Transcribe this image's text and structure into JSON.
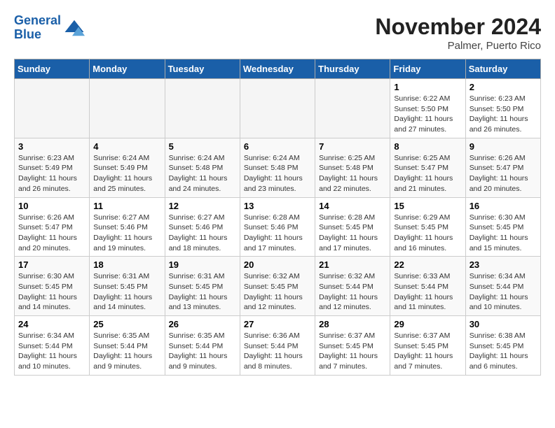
{
  "header": {
    "logo_line1": "General",
    "logo_line2": "Blue",
    "month": "November 2024",
    "location": "Palmer, Puerto Rico"
  },
  "weekdays": [
    "Sunday",
    "Monday",
    "Tuesday",
    "Wednesday",
    "Thursday",
    "Friday",
    "Saturday"
  ],
  "weeks": [
    [
      {
        "day": "",
        "info": ""
      },
      {
        "day": "",
        "info": ""
      },
      {
        "day": "",
        "info": ""
      },
      {
        "day": "",
        "info": ""
      },
      {
        "day": "",
        "info": ""
      },
      {
        "day": "1",
        "info": "Sunrise: 6:22 AM\nSunset: 5:50 PM\nDaylight: 11 hours and 27 minutes."
      },
      {
        "day": "2",
        "info": "Sunrise: 6:23 AM\nSunset: 5:50 PM\nDaylight: 11 hours and 26 minutes."
      }
    ],
    [
      {
        "day": "3",
        "info": "Sunrise: 6:23 AM\nSunset: 5:49 PM\nDaylight: 11 hours and 26 minutes."
      },
      {
        "day": "4",
        "info": "Sunrise: 6:24 AM\nSunset: 5:49 PM\nDaylight: 11 hours and 25 minutes."
      },
      {
        "day": "5",
        "info": "Sunrise: 6:24 AM\nSunset: 5:48 PM\nDaylight: 11 hours and 24 minutes."
      },
      {
        "day": "6",
        "info": "Sunrise: 6:24 AM\nSunset: 5:48 PM\nDaylight: 11 hours and 23 minutes."
      },
      {
        "day": "7",
        "info": "Sunrise: 6:25 AM\nSunset: 5:48 PM\nDaylight: 11 hours and 22 minutes."
      },
      {
        "day": "8",
        "info": "Sunrise: 6:25 AM\nSunset: 5:47 PM\nDaylight: 11 hours and 21 minutes."
      },
      {
        "day": "9",
        "info": "Sunrise: 6:26 AM\nSunset: 5:47 PM\nDaylight: 11 hours and 20 minutes."
      }
    ],
    [
      {
        "day": "10",
        "info": "Sunrise: 6:26 AM\nSunset: 5:47 PM\nDaylight: 11 hours and 20 minutes."
      },
      {
        "day": "11",
        "info": "Sunrise: 6:27 AM\nSunset: 5:46 PM\nDaylight: 11 hours and 19 minutes."
      },
      {
        "day": "12",
        "info": "Sunrise: 6:27 AM\nSunset: 5:46 PM\nDaylight: 11 hours and 18 minutes."
      },
      {
        "day": "13",
        "info": "Sunrise: 6:28 AM\nSunset: 5:46 PM\nDaylight: 11 hours and 17 minutes."
      },
      {
        "day": "14",
        "info": "Sunrise: 6:28 AM\nSunset: 5:45 PM\nDaylight: 11 hours and 17 minutes."
      },
      {
        "day": "15",
        "info": "Sunrise: 6:29 AM\nSunset: 5:45 PM\nDaylight: 11 hours and 16 minutes."
      },
      {
        "day": "16",
        "info": "Sunrise: 6:30 AM\nSunset: 5:45 PM\nDaylight: 11 hours and 15 minutes."
      }
    ],
    [
      {
        "day": "17",
        "info": "Sunrise: 6:30 AM\nSunset: 5:45 PM\nDaylight: 11 hours and 14 minutes."
      },
      {
        "day": "18",
        "info": "Sunrise: 6:31 AM\nSunset: 5:45 PM\nDaylight: 11 hours and 14 minutes."
      },
      {
        "day": "19",
        "info": "Sunrise: 6:31 AM\nSunset: 5:45 PM\nDaylight: 11 hours and 13 minutes."
      },
      {
        "day": "20",
        "info": "Sunrise: 6:32 AM\nSunset: 5:45 PM\nDaylight: 11 hours and 12 minutes."
      },
      {
        "day": "21",
        "info": "Sunrise: 6:32 AM\nSunset: 5:44 PM\nDaylight: 11 hours and 12 minutes."
      },
      {
        "day": "22",
        "info": "Sunrise: 6:33 AM\nSunset: 5:44 PM\nDaylight: 11 hours and 11 minutes."
      },
      {
        "day": "23",
        "info": "Sunrise: 6:34 AM\nSunset: 5:44 PM\nDaylight: 11 hours and 10 minutes."
      }
    ],
    [
      {
        "day": "24",
        "info": "Sunrise: 6:34 AM\nSunset: 5:44 PM\nDaylight: 11 hours and 10 minutes."
      },
      {
        "day": "25",
        "info": "Sunrise: 6:35 AM\nSunset: 5:44 PM\nDaylight: 11 hours and 9 minutes."
      },
      {
        "day": "26",
        "info": "Sunrise: 6:35 AM\nSunset: 5:44 PM\nDaylight: 11 hours and 9 minutes."
      },
      {
        "day": "27",
        "info": "Sunrise: 6:36 AM\nSunset: 5:44 PM\nDaylight: 11 hours and 8 minutes."
      },
      {
        "day": "28",
        "info": "Sunrise: 6:37 AM\nSunset: 5:45 PM\nDaylight: 11 hours and 7 minutes."
      },
      {
        "day": "29",
        "info": "Sunrise: 6:37 AM\nSunset: 5:45 PM\nDaylight: 11 hours and 7 minutes."
      },
      {
        "day": "30",
        "info": "Sunrise: 6:38 AM\nSunset: 5:45 PM\nDaylight: 11 hours and 6 minutes."
      }
    ]
  ]
}
